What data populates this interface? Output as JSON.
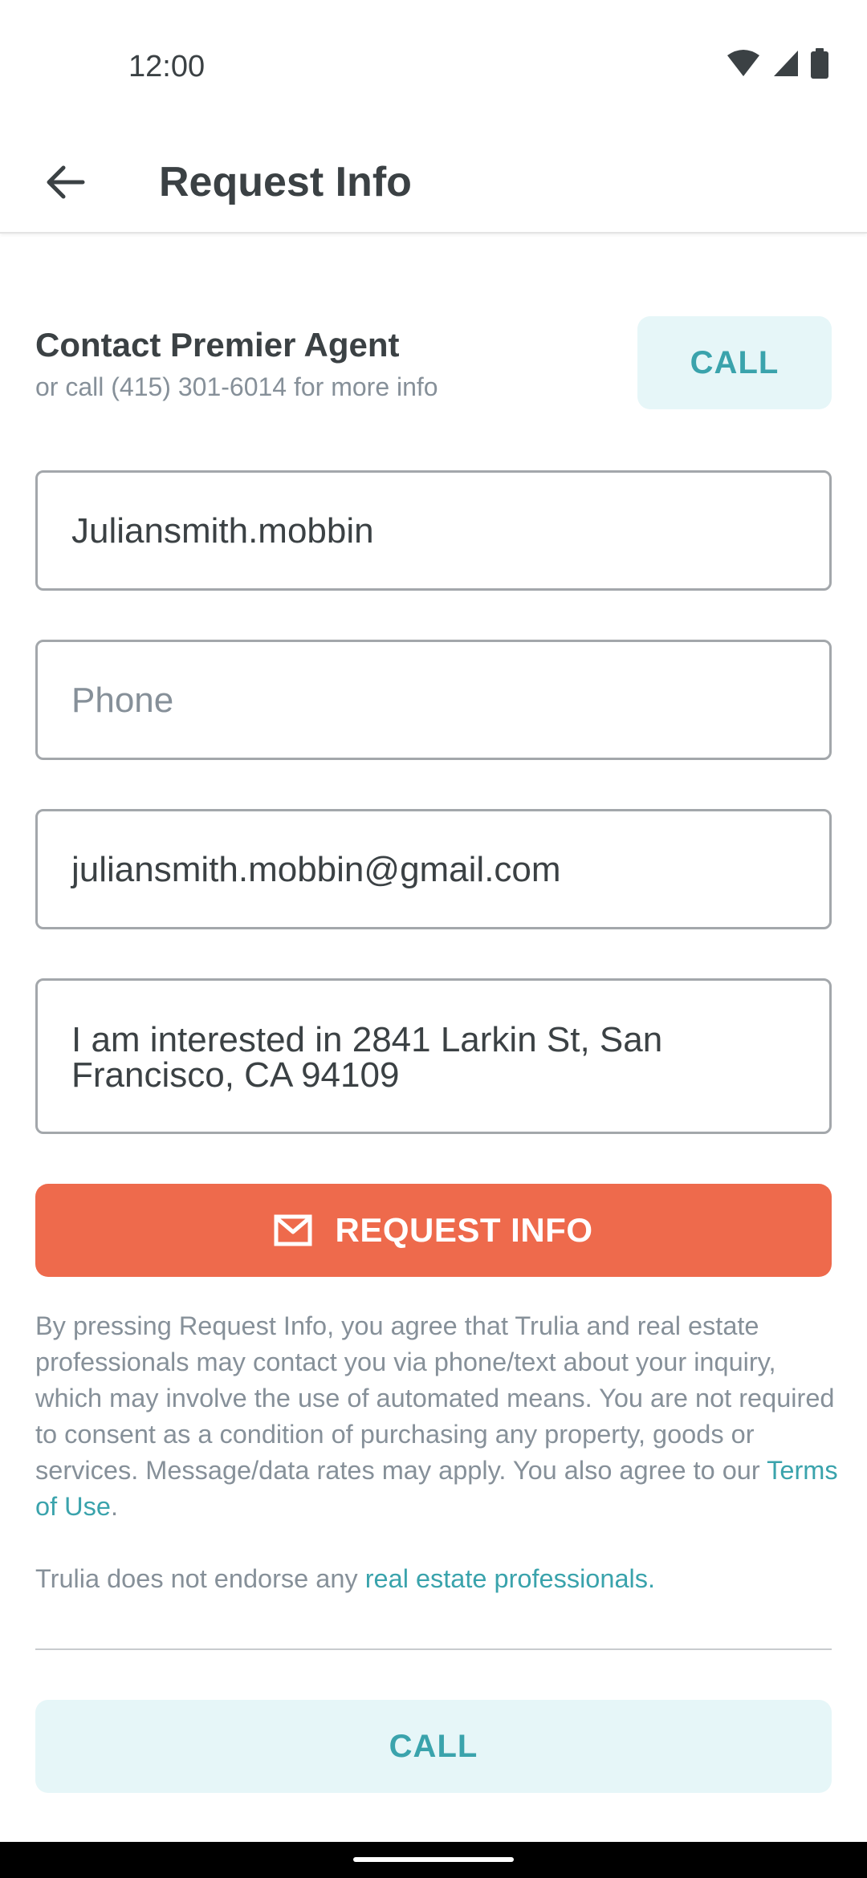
{
  "status_bar": {
    "time": "12:00"
  },
  "app_bar": {
    "title": "Request Info"
  },
  "contact": {
    "title": "Contact Premier Agent",
    "subtitle": "or call (415) 301-6014 for more info",
    "call_label": "CALL"
  },
  "form": {
    "name_value": "Juliansmith.mobbin",
    "phone_placeholder": "Phone",
    "email_value": "juliansmith.mobbin@gmail.com",
    "message_value": "I am interested in 2841 Larkin St, San Francisco, CA 94109"
  },
  "request_button": {
    "label": "REQUEST INFO",
    "icon": "mail-icon"
  },
  "disclaimer": {
    "text": "By pressing Request Info, you agree that Trulia and real estate professionals may contact you via phone/text about your inquiry, which may involve the use of automated means. You are not required to consent as a condition of purchasing any property, goods or services. Message/data rates may apply. You also agree to our ",
    "terms_link": "Terms of Use",
    "terms_suffix": "."
  },
  "endorse": {
    "text": "Trulia does not endorse any ",
    "link": "real estate professionals",
    "suffix": "."
  },
  "bottom_call": {
    "label": "CALL"
  },
  "colors": {
    "accent": "#3aa3ac",
    "primary_button": "#ee6a4c",
    "call_button_bg": "#e6f6f8",
    "text_primary": "#3b4144",
    "text_secondary": "#869099"
  }
}
